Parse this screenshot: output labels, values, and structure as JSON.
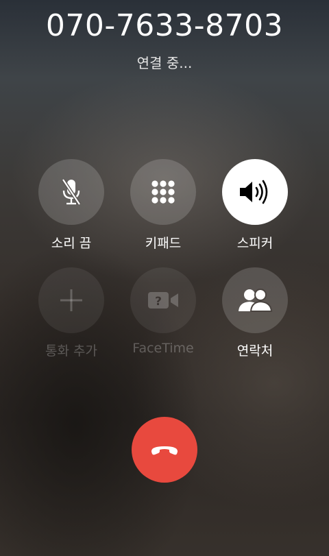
{
  "call": {
    "number": "070-7633-8703",
    "status": "연결 중..."
  },
  "controls": {
    "mute": {
      "label": "소리 끔",
      "icon": "mic-off-icon",
      "state": "normal"
    },
    "keypad": {
      "label": "키패드",
      "icon": "keypad-icon",
      "state": "normal"
    },
    "speaker": {
      "label": "스피커",
      "icon": "speaker-icon",
      "state": "active"
    },
    "add_call": {
      "label": "통화 추가",
      "icon": "plus-icon",
      "state": "disabled"
    },
    "facetime": {
      "label": "FaceTime",
      "icon": "facetime-icon",
      "state": "disabled"
    },
    "contacts": {
      "label": "연락처",
      "icon": "contacts-icon",
      "state": "normal"
    }
  },
  "end_call": {
    "icon": "end-call-icon",
    "color": "#e8493e"
  }
}
